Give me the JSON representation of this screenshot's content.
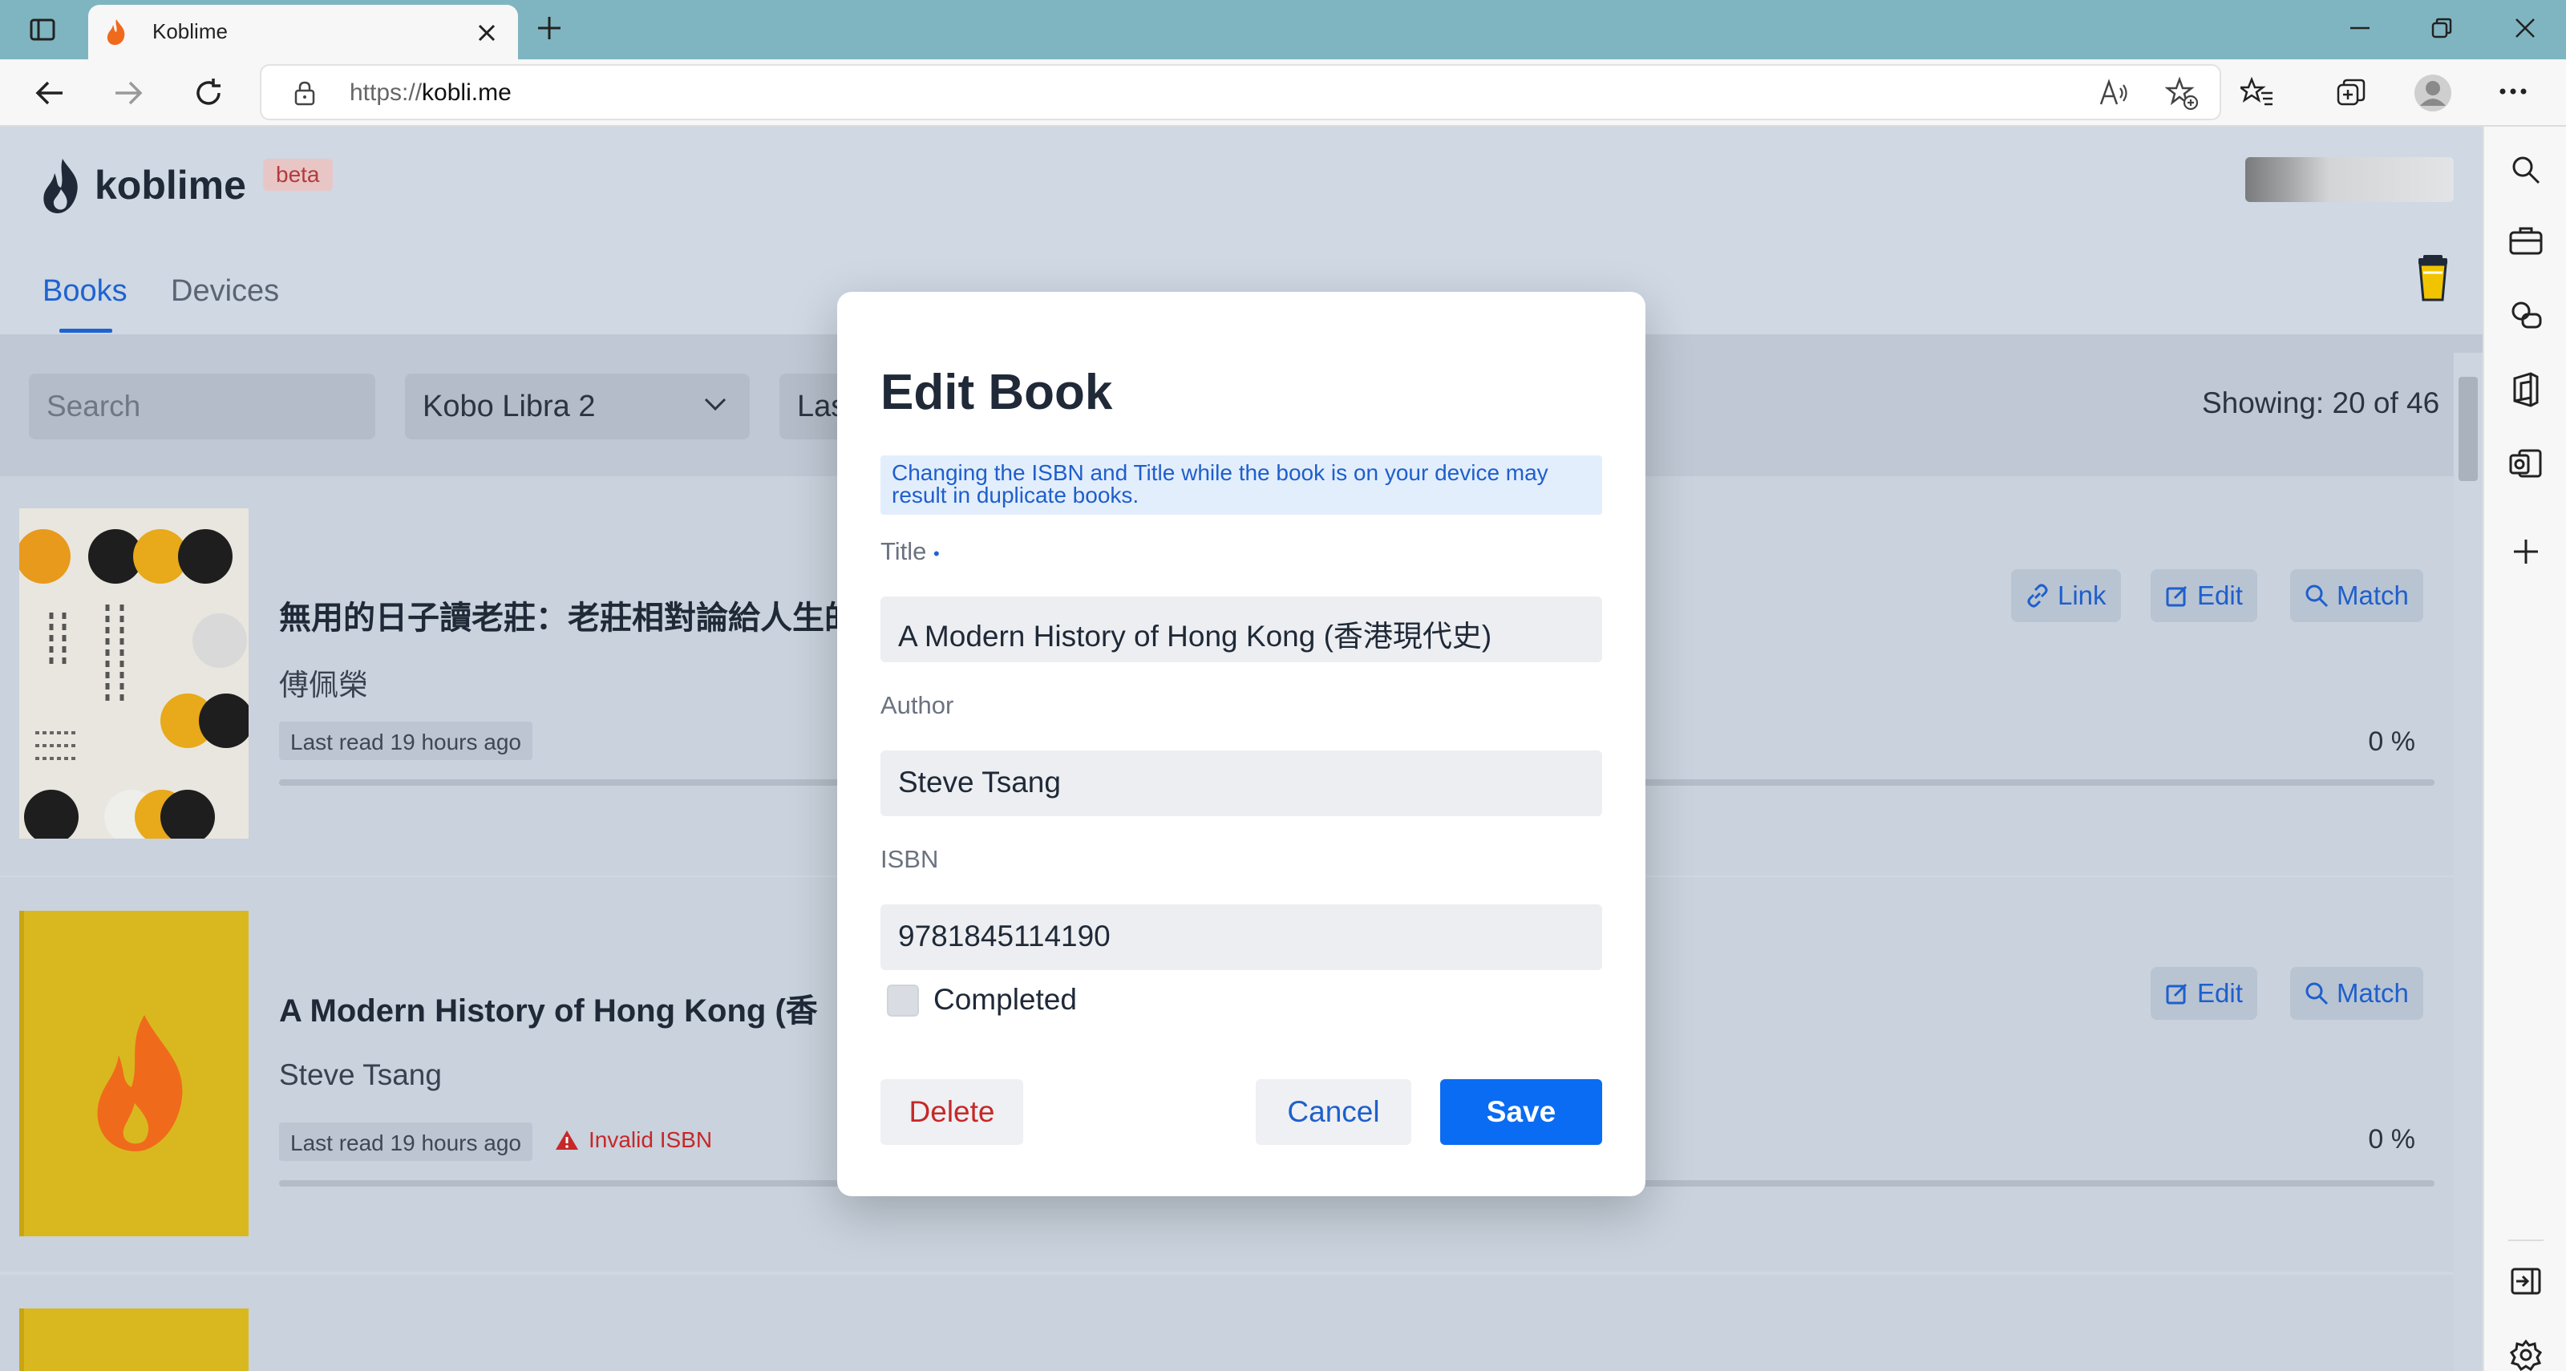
{
  "browser": {
    "tab_title": "Koblime",
    "url_prefix": "https://",
    "url_host": "kobli.me"
  },
  "app": {
    "logo_text": "koblime",
    "badge": "beta",
    "tabs": [
      "Books",
      "Devices"
    ],
    "active_tab": "Books"
  },
  "controls": {
    "search_placeholder": "Search",
    "device_selected": "Kobo Libra 2",
    "sort_selected": "Las",
    "showing": "Showing: 20 of 46"
  },
  "books": [
    {
      "title": "無用的日子讀老莊：老莊相對論給人生的",
      "author": "傅佩榮",
      "last_read": "Last read 19 hours ago",
      "progress_label": "0 %",
      "progress": 0,
      "actions": [
        "Link",
        "Edit",
        "Match"
      ]
    },
    {
      "title": "A Modern History of Hong Kong (香",
      "author": "Steve Tsang",
      "last_read": "Last read 19 hours ago",
      "warning": "Invalid ISBN",
      "progress_label": "0 %",
      "progress": 0,
      "actions": [
        "Edit",
        "Match"
      ]
    }
  ],
  "dialog": {
    "title": "Edit Book",
    "notice": "Changing the ISBN and Title while the book is on your device may result in duplicate books.",
    "title_label": "Title",
    "required_mark": "•",
    "title_value": "A Modern History of Hong Kong (香港現代史)",
    "author_label": "Author",
    "author_value": "Steve Tsang",
    "isbn_label": "ISBN",
    "isbn_value": "9781845114190",
    "completed_label": "Completed",
    "completed": false,
    "delete_label": "Delete",
    "cancel_label": "Cancel",
    "save_label": "Save"
  },
  "colors": {
    "accent": "#0a6cf2",
    "danger": "#c62828",
    "chrome": "#7fb5c1"
  },
  "icons": [
    "sidebar-toggle-icon",
    "flame-icon",
    "close-icon",
    "plus-icon",
    "minimize-icon",
    "restore-icon",
    "back-icon",
    "forward-icon",
    "refresh-icon",
    "lock-icon",
    "read-aloud-icon",
    "add-favorite-icon",
    "favorites-icon",
    "collections-icon",
    "profile-icon",
    "more-icon",
    "search-icon",
    "briefcase-icon",
    "games-icon",
    "office-icon",
    "outlook-icon",
    "sidebar-hide-icon",
    "settings-icon",
    "chevron-down-icon",
    "link-icon",
    "edit-icon",
    "cup-icon",
    "warning-icon"
  ]
}
